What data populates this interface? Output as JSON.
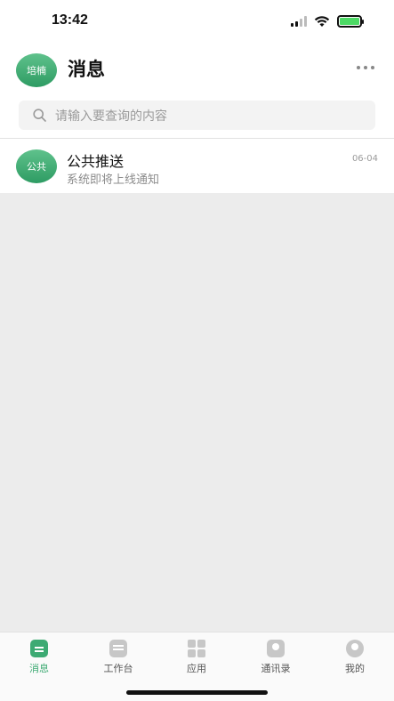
{
  "status_bar": {
    "time": "13:42"
  },
  "header": {
    "avatar_text": "培楠",
    "title": "消息"
  },
  "search": {
    "placeholder": "请输入要查询的内容"
  },
  "messages": [
    {
      "avatar_text": "公共",
      "title": "公共推送",
      "subtitle": "系统即将上线通知",
      "date": "06-04"
    }
  ],
  "tabs": [
    {
      "label": "消息",
      "icon": "message-icon",
      "active": true
    },
    {
      "label": "工作台",
      "icon": "workbench-icon",
      "active": false
    },
    {
      "label": "应用",
      "icon": "apps-icon",
      "active": false
    },
    {
      "label": "通讯录",
      "icon": "contacts-icon",
      "active": false
    },
    {
      "label": "我的",
      "icon": "profile-icon",
      "active": false
    }
  ],
  "colors": {
    "accent": "#3daa73",
    "avatar_green": "#4cb57f"
  }
}
